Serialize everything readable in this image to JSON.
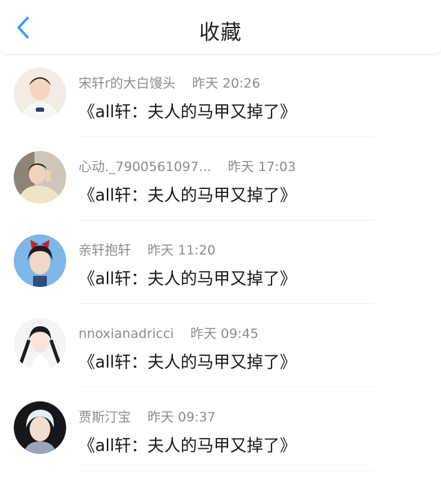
{
  "header": {
    "title": "收藏",
    "back_icon": "chevron-left-icon",
    "accent_color": "#3a9cf3"
  },
  "items": [
    {
      "user": "宋轩r的大白馒头",
      "time": "昨天 20:26",
      "title": "《all轩：夫人的马甲又掉了》"
    },
    {
      "user": "心动._7900561097...",
      "time": "昨天 17:03",
      "title": "《all轩：夫人的马甲又掉了》"
    },
    {
      "user": "亲轩抱轩",
      "time": "昨天 11:20",
      "title": "《all轩：夫人的马甲又掉了》"
    },
    {
      "user": "nnoxianadricci",
      "time": "昨天 09:45",
      "title": "《all轩：夫人的马甲又掉了》"
    },
    {
      "user": "贾斯汀宝",
      "time": "昨天 09:37",
      "title": "《all轩：夫人的马甲又掉了》"
    }
  ]
}
